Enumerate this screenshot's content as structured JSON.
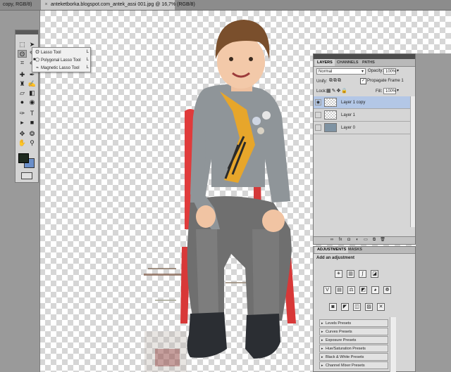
{
  "tabs": [
    {
      "label": "copy, RGB/8)",
      "close": "×"
    },
    {
      "label": "anteketborka.blogspot.com_antek_assi 001.jpg @ 16,7% (RGB/8)",
      "close": "×"
    }
  ],
  "flyout": {
    "items": [
      {
        "label": "Lasso Tool",
        "key": "L"
      },
      {
        "label": "Polygonal Lasso Tool",
        "key": "L"
      },
      {
        "label": "Magnetic Lasso Tool",
        "key": "L"
      }
    ]
  },
  "layers_panel": {
    "tabs": [
      "LAYERS",
      "CHANNELS",
      "PATHS"
    ],
    "blend_mode": "Normal",
    "opacity_label": "Opacity:",
    "opacity_value": "100%",
    "unify_label": "Unify:",
    "propagate_label": "Propagate Frame 1",
    "lock_label": "Lock:",
    "fill_label": "Fill:",
    "fill_value": "100%",
    "layers": [
      {
        "name": "Layer 1 copy",
        "visible": true,
        "selected": true
      },
      {
        "name": "Layer 1",
        "visible": false,
        "selected": false
      },
      {
        "name": "Layer 0",
        "visible": false,
        "selected": false
      }
    ]
  },
  "adjustments_panel": {
    "tabs": [
      "ADJUSTMENTS",
      "MASKS"
    ],
    "title": "Add an adjustment",
    "presets": [
      "Levels Presets",
      "Curves Presets",
      "Exposure Presets",
      "Hue/Saturation Presets",
      "Black & White Presets",
      "Channel Mixer Presets"
    ]
  },
  "colors": {
    "foreground": "#1f2a20",
    "background": "#6b8fc9",
    "selection": "#b3c7e6"
  }
}
